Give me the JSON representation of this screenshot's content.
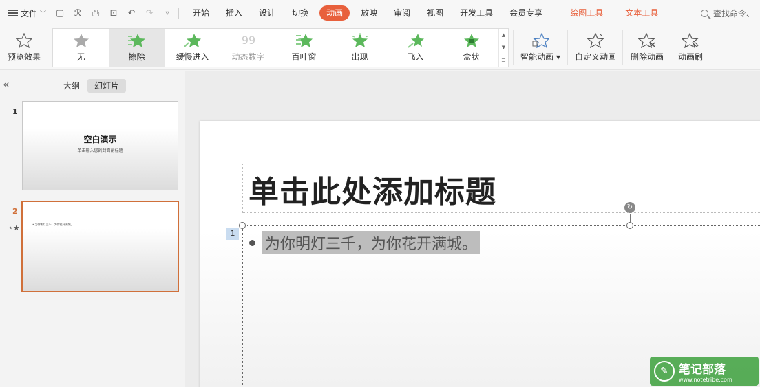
{
  "menubar": {
    "file_label": "文件",
    "tabs": [
      "开始",
      "插入",
      "设计",
      "切换",
      "动画",
      "放映",
      "审阅",
      "视图",
      "开发工具",
      "会员专享"
    ],
    "active_tab": "动画",
    "context_tabs": [
      "绘图工具",
      "文本工具"
    ],
    "search_placeholder": "查找命令、"
  },
  "ribbon": {
    "preview_label": "预览效果",
    "gallery": [
      {
        "label": "无"
      },
      {
        "label": "擦除"
      },
      {
        "label": "缓慢进入"
      },
      {
        "label": "动态数字"
      },
      {
        "label": "百叶窗"
      },
      {
        "label": "出现"
      },
      {
        "label": "飞入"
      },
      {
        "label": "盒状"
      }
    ],
    "selected_effect": "擦除",
    "smart_anim_label": "智能动画",
    "custom_anim_label": "自定义动画",
    "delete_anim_label": "删除动画",
    "anim_brush_label": "动画刷"
  },
  "panel": {
    "tabs": [
      "大纲",
      "幻灯片"
    ],
    "selected_tab": "幻灯片",
    "slides": [
      {
        "number": "1",
        "title": "空白演示",
        "subtitle": "单击输入您的封面副标题"
      },
      {
        "number": "2",
        "text": "为你明灯三千，为你花开满城。"
      }
    ]
  },
  "slide": {
    "title": "单击此处添加标题",
    "anim_order": "1",
    "bullet": "为你明灯三千，为你花开满城。"
  },
  "watermark": {
    "name": "笔记部落",
    "url": "www.notetribe.com"
  },
  "colors": {
    "accent": "#e8603c",
    "star_green": "#5cb85c"
  }
}
